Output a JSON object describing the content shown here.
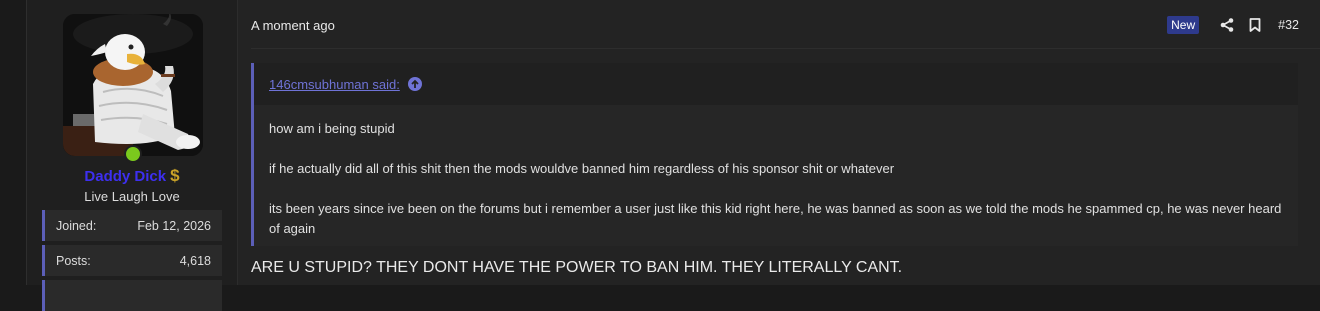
{
  "user": {
    "avatar_icon": "eagle-avatar-image",
    "username": "Daddy Dick",
    "username_badge": "$",
    "user_title": "Live Laugh Love",
    "stats": [
      {
        "label": "Joined:",
        "value": "Feb 12, 2026"
      },
      {
        "label": "Posts:",
        "value": "4,618"
      }
    ],
    "online_color": "#7bc91d",
    "username_color": "#3d2ff0"
  },
  "post": {
    "time": "A moment ago",
    "new_badge": "New",
    "post_number": "#32",
    "quote": {
      "author": "146cmsubhuman said:",
      "paragraphs": [
        "how am i being stupid",
        "if he actually did all of this shit then the mods wouldve banned him regardless of his sponsor shit or whatever",
        "its been years since ive been on the forums but i remember a user just like this kid right here, he was banned as soon as we told the mods he spammed cp, he was never heard of again"
      ]
    },
    "message": "ARE U STUPID? THEY DONT HAVE THE POWER TO BAN HIM. THEY LITERALLY CANT."
  },
  "colors": {
    "accent": "#5c5fb8",
    "new_badge_bg": "#2e3a8c",
    "link": "#6f73d6"
  }
}
